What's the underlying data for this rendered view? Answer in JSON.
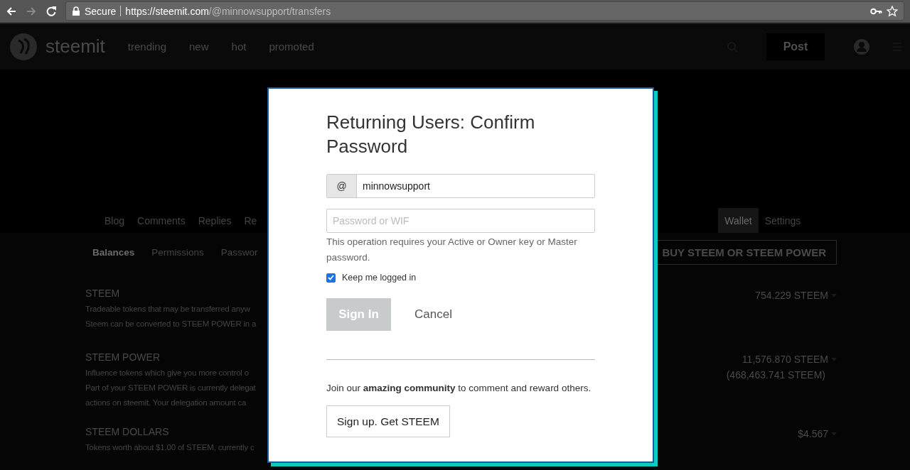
{
  "browser": {
    "forward_enabled": false,
    "secure_label": "Secure",
    "url_host": "https://steemit.com",
    "url_path": "/@minnowsupport/transfers"
  },
  "header": {
    "logo_text": "steemit",
    "nav": [
      "trending",
      "new",
      "hot",
      "promoted"
    ],
    "post_button": "Post"
  },
  "profile_tabs": [
    {
      "label": "Blog",
      "selected": false
    },
    {
      "label": "Comments",
      "selected": false
    },
    {
      "label": "Replies",
      "selected": false
    },
    {
      "label": "Re",
      "selected": false
    },
    {
      "label": "Wallet",
      "selected": true
    },
    {
      "label": "Settings",
      "selected": false
    }
  ],
  "wallet_tabs": [
    {
      "label": "Balances",
      "selected": true
    },
    {
      "label": "Permissions",
      "selected": false
    },
    {
      "label": "Passwor",
      "selected": false
    }
  ],
  "buy_button": "BUY STEEM OR STEEM POWER",
  "balances": [
    {
      "title": "STEEM",
      "description": [
        "Tradeable tokens that may be transferred anyw",
        "Steem can be converted to STEEM POWER in a"
      ],
      "amounts": [
        "754.229 STEEM"
      ]
    },
    {
      "title": "STEEM POWER",
      "description": [
        "Influence tokens which give you more control o",
        "Part of your STEEM POWER is currently delegat",
        "actions on steemit. Your delegation amount ca"
      ],
      "amounts": [
        "11,576.870 STEEM",
        "(468,463.741 STEEM)"
      ]
    },
    {
      "title": "STEEM DOLLARS",
      "description": [
        "Tokens worth about $1.00 of STEEM, currently c"
      ],
      "amounts": [
        "$4.567"
      ]
    }
  ],
  "modal": {
    "title": "Returning Users: Confirm Password",
    "username_prefix": "@",
    "username": "minnowsupport",
    "password_placeholder": "Password or WIF",
    "help_text": "This operation requires your Active or Owner key or Master password.",
    "keep_logged_in": {
      "label": "Keep me logged in",
      "checked": true
    },
    "sign_in_button": {
      "label": "Sign In",
      "disabled": true
    },
    "cancel_button": "Cancel",
    "join_text": "Join our **amazing community** to comment and reward others.",
    "signup_button": "Sign up. Get STEEM"
  }
}
